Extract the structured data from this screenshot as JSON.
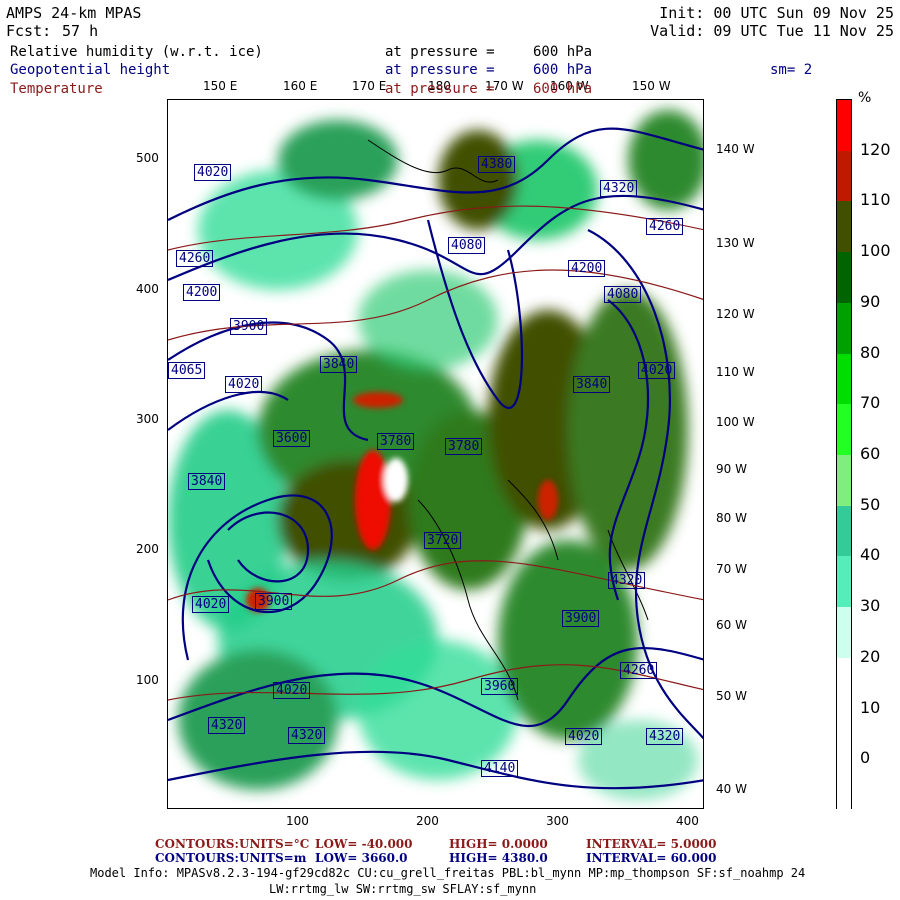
{
  "header": {
    "model": "AMPS 24-km MPAS",
    "fcst_label": "Fcst:",
    "fcst_value": "57 h",
    "init": "Init: 00 UTC Sun 09 Nov 25",
    "valid": "Valid: 09 UTC Tue 11 Nov 25"
  },
  "fields": [
    {
      "name": "Relative humidity (w.r.t. ice)",
      "pressure_label": "at pressure =",
      "pressure_value": "600 hPa",
      "color": "#000000"
    },
    {
      "name": "Geopotential height",
      "pressure_label": "at pressure =",
      "pressure_value": "600 hPa",
      "color": "#000080"
    },
    {
      "name": "Temperature",
      "pressure_label": "at pressure =",
      "pressure_value": "600 hPa",
      "color": "#8b1a1a"
    }
  ],
  "smoothing": "sm= 2",
  "axes": {
    "top_lon": [
      "150 E",
      "160 E",
      "170 E",
      "180",
      "170 W",
      "160 W",
      "150 W"
    ],
    "right_lon": [
      "140 W",
      "130 W",
      "120 W",
      "110 W",
      "100 W",
      "90 W",
      "80 W",
      "70 W",
      "60 W",
      "50 W",
      "40 W"
    ],
    "left_y": [
      "500",
      "400",
      "300",
      "200",
      "100"
    ],
    "bottom_x": [
      "100",
      "200",
      "300",
      "400"
    ]
  },
  "colorbar": {
    "unit": "%",
    "labels": [
      "120",
      "110",
      "100",
      "90",
      "80",
      "70",
      "60",
      "50",
      "40",
      "30",
      "20",
      "10",
      "0"
    ],
    "colors": [
      "#ff0000",
      "#bf1a00",
      "#405000",
      "#006400",
      "#00a000",
      "#00dd00",
      "#22ff22",
      "#7fee7f",
      "#33cc99",
      "#55eebb",
      "#ccffee",
      "#ffffff",
      "#ffffff",
      "#ffffff"
    ]
  },
  "height_labels": [
    {
      "v": "4020"
    },
    {
      "v": "4260"
    },
    {
      "v": "4200"
    },
    {
      "v": "3900"
    },
    {
      "v": "4065"
    },
    {
      "v": "4020"
    },
    {
      "v": "3600"
    },
    {
      "v": "3840"
    },
    {
      "v": "3780"
    },
    {
      "v": "4020"
    },
    {
      "v": "3900"
    },
    {
      "v": "4080"
    },
    {
      "v": "4200"
    },
    {
      "v": "4320"
    },
    {
      "v": "3780"
    },
    {
      "v": "4320"
    },
    {
      "v": "3900"
    },
    {
      "v": "3720"
    },
    {
      "v": "4140"
    },
    {
      "v": "4320"
    },
    {
      "v": "4320"
    },
    {
      "v": "4020"
    },
    {
      "v": "4260"
    },
    {
      "v": "4260"
    },
    {
      "v": "4380"
    },
    {
      "v": "4320"
    },
    {
      "v": "4140"
    },
    {
      "v": "4020"
    },
    {
      "v": "4080"
    },
    {
      "v": "3960"
    },
    {
      "v": "3840"
    },
    {
      "v": "4020"
    },
    {
      "v": "3840"
    },
    {
      "v": "4260"
    },
    {
      "v": "3900"
    },
    {
      "v": "4380"
    },
    {
      "v": "4320"
    },
    {
      "v": "4320"
    },
    {
      "v": "4020"
    },
    {
      "v": "3960"
    }
  ],
  "footer": {
    "line1": {
      "contours": "CONTOURS:",
      "units": "UNITS=°C",
      "low": "LOW= -40.000",
      "high": "HIGH= 0.0000",
      "interval": "INTERVAL= 5.0000"
    },
    "line2": {
      "contours": "CONTOURS:",
      "units": "UNITS=m",
      "low": "LOW= 3660.0",
      "high": "HIGH= 4380.0",
      "interval": "INTERVAL= 60.000"
    },
    "info1": "Model Info: MPASv8.2.3-194-gf29cd82c CU:cu_grell_freitas PBL:bl_mynn MP:mp_thompson SF:sf_noahmp 24",
    "info2": "LW:rrtmg_lw SW:rrtmg_sw SFLAY:sf_mynn"
  }
}
